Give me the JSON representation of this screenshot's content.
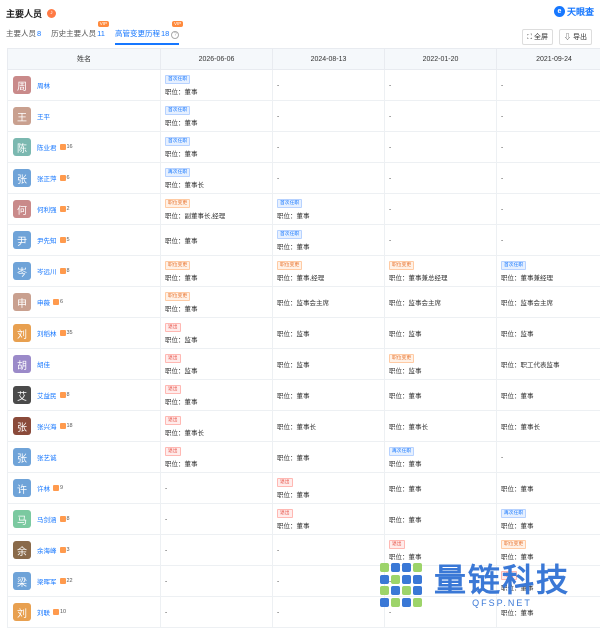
{
  "header": {
    "title": "主要人员",
    "brand": "天眼查"
  },
  "tabs": [
    {
      "label": "主要人员",
      "count": "8",
      "vip": ""
    },
    {
      "label": "历史主要人员",
      "count": "11",
      "vip": "VIP"
    },
    {
      "label": "高管变更历程",
      "count": "18",
      "vip": "VIP"
    }
  ],
  "tools": {
    "fullscreen": "全屏",
    "export": "导出"
  },
  "table": {
    "headers": [
      "姓名",
      "2026-06-06",
      "2024-08-13",
      "2022-01-20",
      "2021-09-24"
    ],
    "rows": [
      {
        "avatar": "周",
        "color": "#c98a8a",
        "name": "周林",
        "risk": "",
        "cells": [
          {
            "tag": "首次任职",
            "t": "b",
            "line": "职位：董事"
          },
          {
            "line": "-"
          },
          {
            "line": "-"
          },
          {
            "line": "-"
          }
        ]
      },
      {
        "avatar": "王",
        "color": "#c9a08f",
        "name": "王平",
        "risk": "",
        "cells": [
          {
            "tag": "首次任职",
            "t": "b",
            "line": "职位：董事"
          },
          {
            "line": "-"
          },
          {
            "line": "-"
          },
          {
            "line": "-"
          }
        ]
      },
      {
        "avatar": "陈",
        "color": "#7bb8b0",
        "name": "陈业君",
        "risk": "16",
        "cells": [
          {
            "tag": "首次任职",
            "t": "b",
            "line": "职位：董事"
          },
          {
            "line": "-"
          },
          {
            "line": "-"
          },
          {
            "line": "-"
          }
        ]
      },
      {
        "avatar": "张",
        "color": "#6fa3d8",
        "name": "张正萍",
        "risk": "6",
        "cells": [
          {
            "tag": "再次任职",
            "t": "b",
            "line": "职位：董事长"
          },
          {
            "line": "-"
          },
          {
            "line": "-"
          },
          {
            "line": "-"
          }
        ]
      },
      {
        "avatar": "何",
        "color": "#c98a8a",
        "name": "何利强",
        "risk": "2",
        "cells": [
          {
            "tag": "职位变更",
            "t": "o",
            "line": "职位：副董事长,经理"
          },
          {
            "tag": "首次任职",
            "t": "b",
            "line": "职位：董事"
          },
          {
            "line": "-"
          },
          {
            "line": "-"
          }
        ]
      },
      {
        "avatar": "尹",
        "color": "#6fa3d8",
        "name": "尹先知",
        "risk": "5",
        "cells": [
          {
            "line": "职位：董事"
          },
          {
            "tag": "首次任职",
            "t": "b",
            "line": "职位：董事"
          },
          {
            "line": "-"
          },
          {
            "line": "-"
          }
        ]
      },
      {
        "avatar": "岑",
        "color": "#6fa3d8",
        "name": "岑远川",
        "risk": "8",
        "cells": [
          {
            "tag": "职位变更",
            "t": "o",
            "line": "职位：董事"
          },
          {
            "tag": "职位变更",
            "t": "o",
            "line": "职位：董事,经理"
          },
          {
            "tag": "职位变更",
            "t": "o",
            "line": "职位：董事兼总经理"
          },
          {
            "tag": "首次任职",
            "t": "b",
            "line": "职位：董事兼经理"
          }
        ]
      },
      {
        "avatar": "申",
        "color": "#c9a08f",
        "name": "申薇",
        "risk": "6",
        "cells": [
          {
            "tag": "职位变更",
            "t": "o",
            "line": "职位：董事"
          },
          {
            "line": "职位：监事会主席"
          },
          {
            "line": "职位：监事会主席"
          },
          {
            "line": "职位：监事会主席"
          }
        ]
      },
      {
        "avatar": "刘",
        "color": "#e8a050",
        "name": "刘稻林",
        "risk": "35",
        "cells": [
          {
            "tag": "退出",
            "t": "r",
            "line": "职位：监事"
          },
          {
            "line": "职位：监事"
          },
          {
            "line": "职位：监事"
          },
          {
            "line": "职位：监事"
          }
        ]
      },
      {
        "avatar": "胡",
        "color": "#9b8ac9",
        "name": "胡佳",
        "risk": "",
        "cells": [
          {
            "tag": "退出",
            "t": "r",
            "line": "职位：监事"
          },
          {
            "line": "职位：监事"
          },
          {
            "tag": "职位变更",
            "t": "o",
            "line": "职位：监事"
          },
          {
            "line": "职位：职工代表监事"
          }
        ]
      },
      {
        "avatar": "艾",
        "color": "#4a4a4a",
        "name": "艾益民",
        "risk": "8",
        "cells": [
          {
            "tag": "退出",
            "t": "r",
            "line": "职位：董事"
          },
          {
            "line": "职位：董事"
          },
          {
            "line": "职位：董事"
          },
          {
            "line": "职位：董事"
          }
        ]
      },
      {
        "avatar": "张",
        "color": "#8a4a3a",
        "name": "张兴海",
        "risk": "18",
        "cells": [
          {
            "tag": "退出",
            "t": "r",
            "line": "职位：董事长"
          },
          {
            "line": "职位：董事长"
          },
          {
            "line": "职位：董事长"
          },
          {
            "line": "职位：董事长"
          }
        ]
      },
      {
        "avatar": "张",
        "color": "#6fa3d8",
        "name": "张艺诚",
        "risk": "",
        "cells": [
          {
            "tag": "退出",
            "t": "r",
            "line": "职位：董事"
          },
          {
            "line": "职位：董事"
          },
          {
            "tag": "再次任职",
            "t": "b",
            "line": "职位：董事"
          },
          {
            "line": "-"
          }
        ]
      },
      {
        "avatar": "许",
        "color": "#6fa3d8",
        "name": "许林",
        "risk": "9",
        "cells": [
          {
            "line": "-"
          },
          {
            "tag": "退出",
            "t": "r",
            "line": "职位：董事"
          },
          {
            "line": "职位：董事"
          },
          {
            "line": "职位：董事"
          }
        ]
      },
      {
        "avatar": "马",
        "color": "#7bc9a0",
        "name": "马剑涵",
        "risk": "8",
        "cells": [
          {
            "line": "-"
          },
          {
            "tag": "退出",
            "t": "r",
            "line": "职位：董事"
          },
          {
            "line": "职位：董事"
          },
          {
            "tag": "再次任职",
            "t": "b",
            "line": "职位：董事"
          }
        ]
      },
      {
        "avatar": "余",
        "color": "#8a6a4a",
        "name": "余海峰",
        "risk": "3",
        "cells": [
          {
            "line": "-"
          },
          {
            "line": "-"
          },
          {
            "tag": "退出",
            "t": "r",
            "line": "职位：董事"
          },
          {
            "tag": "职位变更",
            "t": "o",
            "line": "职位：董事"
          }
        ]
      },
      {
        "avatar": "梁",
        "color": "#6fa3d8",
        "name": "梁晖军",
        "risk": "22",
        "cells": [
          {
            "line": "-"
          },
          {
            "line": "-"
          },
          {
            "line": "-"
          },
          {
            "tag": "退出",
            "t": "r",
            "line": "职位：董事"
          }
        ]
      },
      {
        "avatar": "刘",
        "color": "#e8a050",
        "name": "刘联",
        "risk": "10",
        "cells": [
          {
            "line": "-"
          },
          {
            "line": "-"
          },
          {
            "line": "-"
          },
          {
            "line": "职位：董事"
          }
        ]
      }
    ]
  },
  "watermark": {
    "text": "量链科技",
    "url": "QFSP.NET",
    "colors": [
      "#9dd46a",
      "#3a78d6",
      "#3a78d6",
      "#9dd46a",
      "#3a78d6",
      "#9dd46a",
      "#3a78d6",
      "#3a78d6",
      "#9dd46a",
      "#3a78d6",
      "#9dd46a",
      "#3a78d6",
      "#3a78d6",
      "#9dd46a",
      "#3a78d6",
      "#9dd46a"
    ]
  }
}
